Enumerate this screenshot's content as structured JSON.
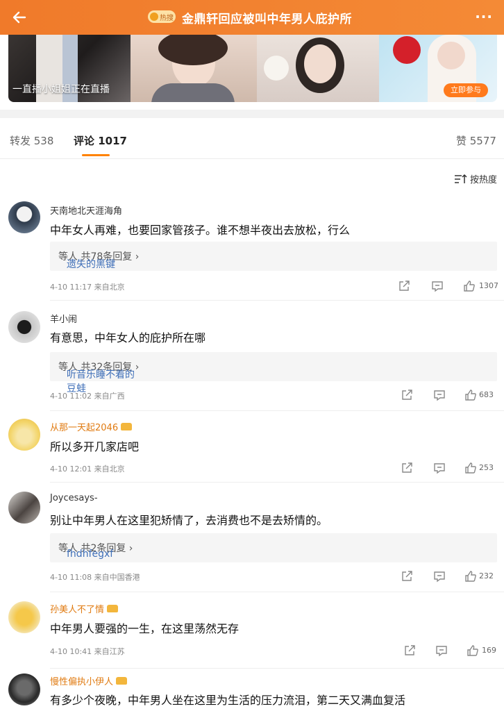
{
  "header": {
    "badge": "热搜",
    "title": "金鼎轩回应被叫中年男人庇护所",
    "more": "···"
  },
  "banner": {
    "live_text": "一直播小姐姐正在直播",
    "join_label": "立即参与"
  },
  "tabs": {
    "repost": "转发 538",
    "comments": "评论 1017",
    "likes": "赞 5577"
  },
  "sort_label": "按热度",
  "comments": [
    {
      "user": "天南地北天涯海角",
      "text": "中年女人再难，也要回家管孩子。谁不想半夜出去放松，行么",
      "reply_who": "遗失的黑键",
      "reply_rest": "等人  共78条回复 ›",
      "time": "4-10 11:17",
      "location": "来自北京",
      "likes": "1307"
    },
    {
      "user": "羊小闹",
      "text": "有意思，中年女人的庇护所在哪",
      "reply_who": "听音乐睡不着的豆蛙",
      "reply_rest": "等人  共32条回复 ›",
      "time": "4-10 11:02",
      "location": "来自广西",
      "likes": "683"
    },
    {
      "user": "从那一天起2046",
      "text": "所以多开几家店吧",
      "time": "4-10 12:01",
      "location": "来自北京",
      "likes": "253"
    },
    {
      "user": "Joycesays-",
      "text": "别让中年男人在这里犯矫情了，去消费也不是去矫情的。",
      "reply_who": "fhdhfegxf",
      "reply_rest": "等人  共2条回复 ›",
      "time": "4-10 11:08",
      "location": "来自中国香港",
      "likes": "232"
    },
    {
      "user": "孙美人不了情",
      "text": "中年男人要强的一生，在这里荡然无存",
      "time": "4-10 10:41",
      "location": "来自江苏",
      "likes": "169"
    },
    {
      "user": "慢性偏执小伊人",
      "text": "有多少个夜晚，中年男人坐在这里为生活的压力流泪，第二天又满血复活"
    }
  ],
  "colors": {
    "header": "#f48a36",
    "accent": "#ff8200",
    "link": "#3f6fb8",
    "vip_name": "#e07a10"
  },
  "icons": [
    "back-arrow-icon",
    "more-icon",
    "sort-icon",
    "share-icon",
    "comment-icon",
    "like-icon",
    "crown-icon"
  ]
}
